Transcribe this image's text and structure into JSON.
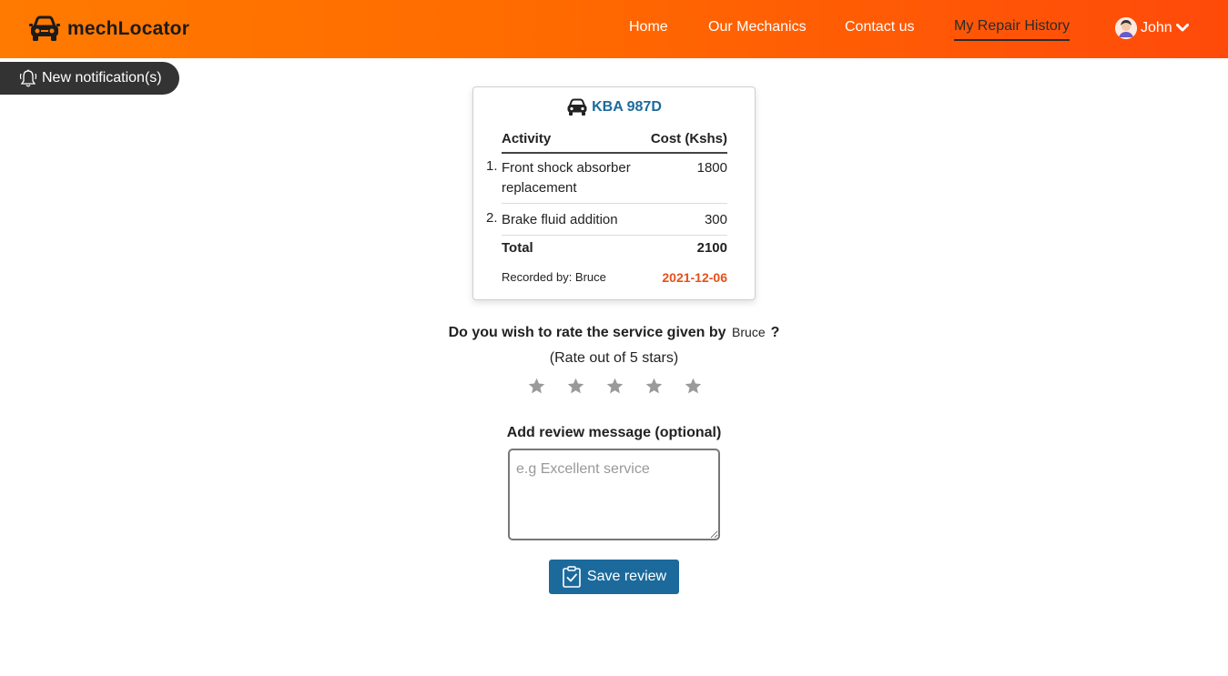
{
  "app": {
    "name": "mechLocator",
    "icon": "car-front-icon"
  },
  "nav": {
    "links": [
      {
        "label": "Home"
      },
      {
        "label": "Our Mechanics"
      },
      {
        "label": "Contact us"
      },
      {
        "label": "My Repair History",
        "active": true
      }
    ],
    "user": {
      "name": "John",
      "avatar": "user-avatar-icon",
      "menu_icon": "chevron-down-icon"
    }
  },
  "notification": {
    "label": "New notification(s)",
    "icon": "bell-ringing-icon"
  },
  "repair": {
    "plate": "KBA 987D",
    "headers": {
      "activity": "Activity",
      "cost": "Cost (Kshs)"
    },
    "items": [
      {
        "num": "1.",
        "activity": "Front shock absorber replacement",
        "cost": "1800"
      },
      {
        "num": "2.",
        "activity": "Brake fluid addition",
        "cost": "300"
      }
    ],
    "total_label": "Total",
    "total_value": "2100",
    "recorded_by": "Recorded by: Bruce",
    "date": "2021-12-06"
  },
  "rating": {
    "question_prefix": "Do you wish to rate the service given by",
    "mechanic": "Bruce",
    "question_suffix": "?",
    "subtitle": "(Rate out of 5 stars)",
    "max_stars": 5,
    "selected": 0
  },
  "review": {
    "label": "Add review message (optional)",
    "placeholder": "e.g Excellent service",
    "value": ""
  },
  "save_button": {
    "label": "Save review",
    "icon": "clipboard-check-icon"
  },
  "colors": {
    "header_start": "#ff7a00",
    "header_end": "#ff4a0a",
    "primary": "#1c6a9c",
    "date": "#e8501a",
    "star": "#9a9a9a"
  }
}
